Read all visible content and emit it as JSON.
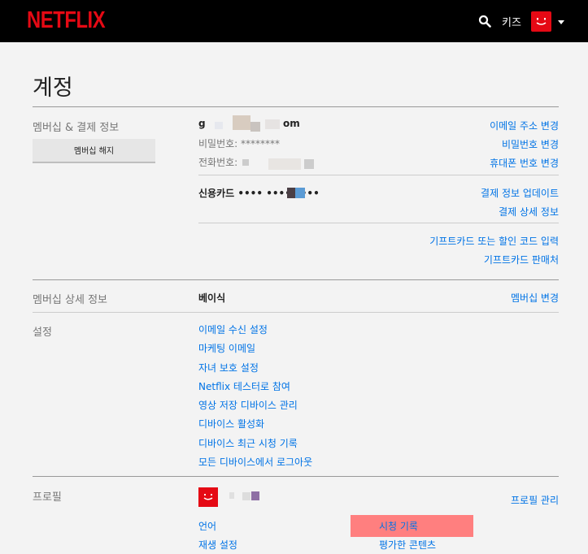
{
  "header": {
    "logo": "NETFLIX",
    "kids_label": "키즈"
  },
  "page_title": "계정",
  "membership": {
    "section_label": "멤버십 & 결제 정보",
    "cancel_button": "멤버십 해지",
    "email_prefix": "g",
    "email_suffix": "om",
    "password_label": "비밀번호: ********",
    "phone_label": "전화번호: ",
    "links": {
      "change_email": "이메일 주소 변경",
      "change_password": "비밀번호 변경",
      "change_phone": "휴대폰 번호 변경"
    },
    "card_text": "신용카드 •••• •••• ••••",
    "payment_links": {
      "update": "결제 정보 업데이트",
      "details": "결제 상세 정보"
    },
    "gift_links": {
      "redeem": "기프트카드 또는 할인 코드 입력",
      "where_to_buy": "기프트카드 판매처"
    }
  },
  "plan": {
    "section_label": "멤버십 상세 정보",
    "plan_name": "베이식",
    "change_link": "멤버십 변경"
  },
  "settings": {
    "section_label": "설정",
    "items": [
      "이메일 수신 설정",
      "마케팅 이메일",
      "자녀 보호 설정",
      "Netflix 테스터로 참여",
      "영상 저장 디바이스 관리",
      "디바이스 활성화",
      "디바이스 최근 시청 기록",
      "모든 디바이스에서 로그아웃"
    ]
  },
  "profile": {
    "section_label": "프로필",
    "manage_link": "프로필 관리",
    "language": "언어",
    "playback": "재생 설정",
    "viewing_activity": "시청 기록",
    "ratings": "평가한 콘텐츠"
  },
  "colors": {
    "brand": "#e50914",
    "link": "#0073e6",
    "highlight": "#ff7f7f"
  },
  "icons": [
    "search-icon",
    "avatar-icon",
    "caret-down-icon"
  ]
}
